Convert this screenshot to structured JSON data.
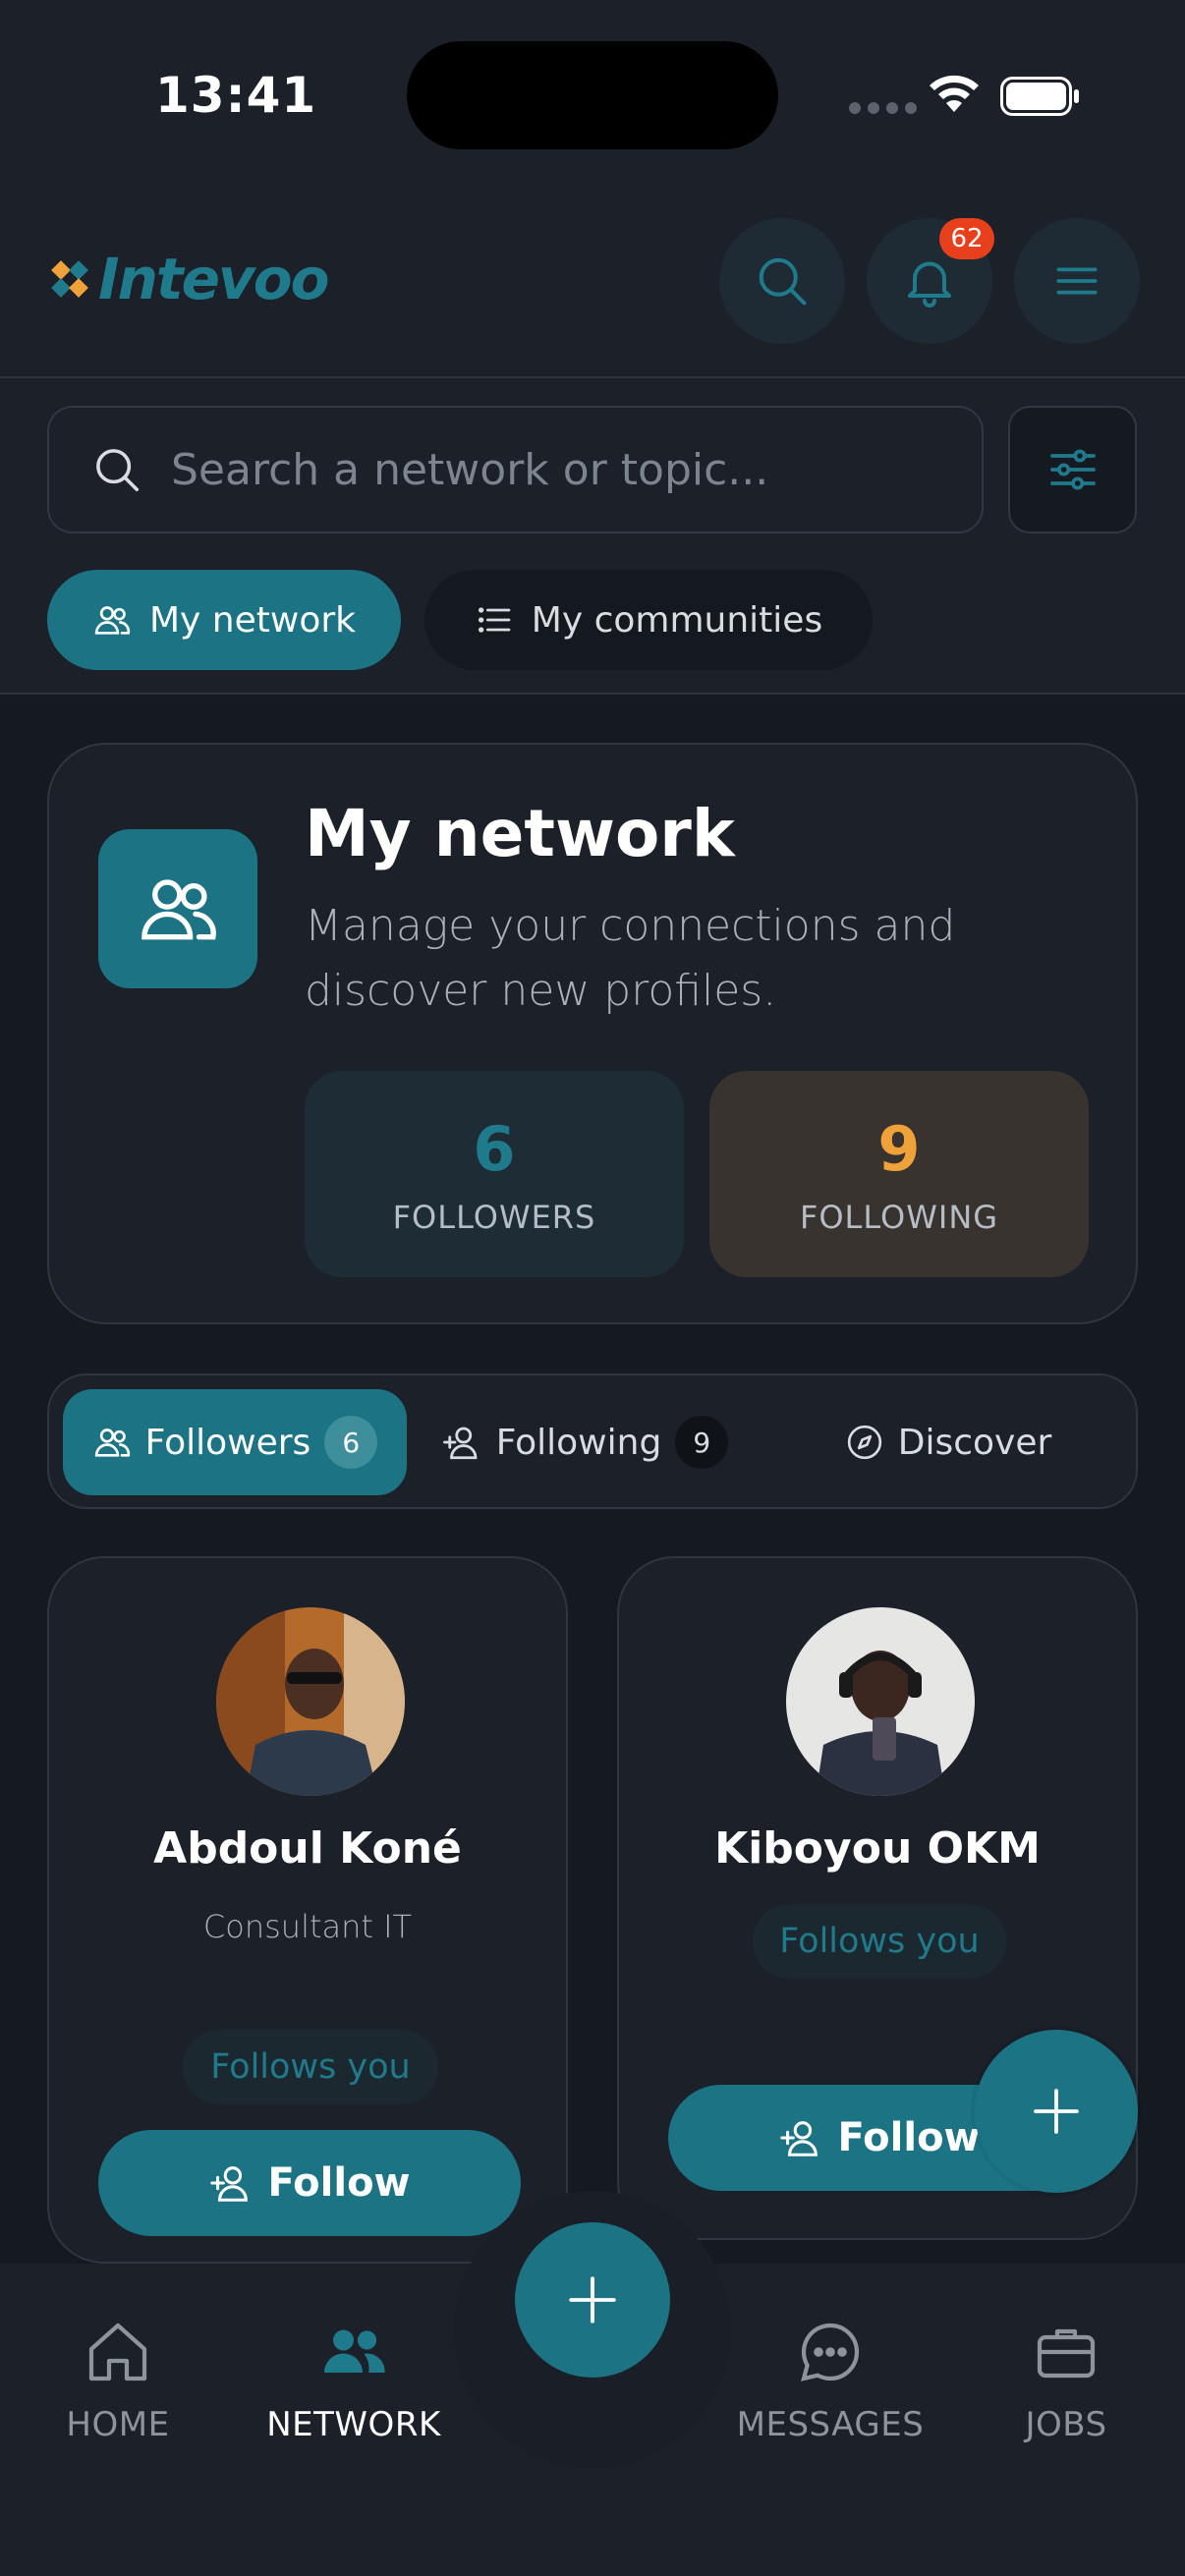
{
  "status_bar": {
    "time": "13:41"
  },
  "header": {
    "logo_text": "Intevoo",
    "notification_count": "62",
    "icons": [
      "search-icon",
      "bell-icon",
      "menu-icon"
    ]
  },
  "search": {
    "placeholder": "Search a network or topic..."
  },
  "top_pills": [
    {
      "label": "My network",
      "icon": "users-icon",
      "active": true
    },
    {
      "label": "My communities",
      "icon": "list-icon",
      "active": false
    }
  ],
  "network_card": {
    "title": "My network",
    "description": "Manage your connections and discover new profiles.",
    "stats": [
      {
        "value": "6",
        "label": "FOLLOWERS",
        "color": "#1f7b8c"
      },
      {
        "value": "9",
        "label": "FOLLOWING",
        "color": "#f0a23a"
      }
    ]
  },
  "tabs": [
    {
      "label": "Followers",
      "count": "6",
      "icon": "users-icon",
      "active": true
    },
    {
      "label": "Following",
      "count": "9",
      "icon": "user-plus-icon",
      "active": false
    },
    {
      "label": "Discover",
      "icon": "compass-icon",
      "active": false
    }
  ],
  "profiles": [
    {
      "name": "Abdoul Koné",
      "role": "Consultant IT",
      "badge": "Follows you",
      "button": "Follow"
    },
    {
      "name": "Kiboyou OKM",
      "badge": "Follows you",
      "button": "Follow"
    }
  ],
  "bottom_nav": [
    {
      "label": "HOME",
      "icon": "home-icon",
      "active": false
    },
    {
      "label": "NETWORK",
      "icon": "users-icon",
      "active": true
    },
    {
      "label": "MESSAGES",
      "icon": "chat-icon",
      "active": false
    },
    {
      "label": "JOBS",
      "icon": "briefcase-icon",
      "active": false
    }
  ],
  "colors": {
    "accent": "#1b7384",
    "background": "#151a21",
    "surface": "#1b2029",
    "badge": "#e8401c",
    "following": "#f0a23a"
  }
}
